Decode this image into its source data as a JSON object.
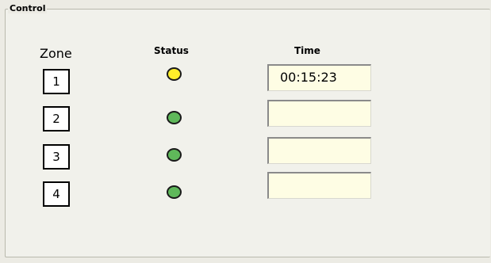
{
  "group": {
    "title": "Control"
  },
  "headers": {
    "zone": "Zone",
    "status": "Status",
    "time": "Time"
  },
  "zones": [
    {
      "label": "1",
      "status": "yellow",
      "time": "00:15:23"
    },
    {
      "label": "2",
      "status": "green",
      "time": ""
    },
    {
      "label": "3",
      "status": "green",
      "time": ""
    },
    {
      "label": "4",
      "status": "green",
      "time": ""
    }
  ],
  "colors": {
    "status_yellow": "#ffee2a",
    "status_green": "#5fb85a",
    "time_field_bg": "#fefde4"
  }
}
